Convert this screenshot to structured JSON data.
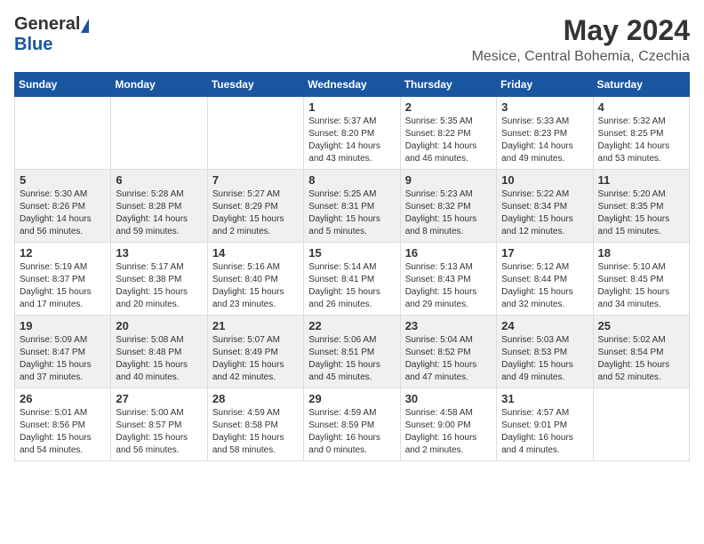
{
  "header": {
    "logo_general": "General",
    "logo_blue": "Blue",
    "month": "May 2024",
    "location": "Mesice, Central Bohemia, Czechia"
  },
  "weekdays": [
    "Sunday",
    "Monday",
    "Tuesday",
    "Wednesday",
    "Thursday",
    "Friday",
    "Saturday"
  ],
  "weeks": [
    [
      {
        "day": "",
        "info": ""
      },
      {
        "day": "",
        "info": ""
      },
      {
        "day": "",
        "info": ""
      },
      {
        "day": "1",
        "info": "Sunrise: 5:37 AM\nSunset: 8:20 PM\nDaylight: 14 hours\nand 43 minutes."
      },
      {
        "day": "2",
        "info": "Sunrise: 5:35 AM\nSunset: 8:22 PM\nDaylight: 14 hours\nand 46 minutes."
      },
      {
        "day": "3",
        "info": "Sunrise: 5:33 AM\nSunset: 8:23 PM\nDaylight: 14 hours\nand 49 minutes."
      },
      {
        "day": "4",
        "info": "Sunrise: 5:32 AM\nSunset: 8:25 PM\nDaylight: 14 hours\nand 53 minutes."
      }
    ],
    [
      {
        "day": "5",
        "info": "Sunrise: 5:30 AM\nSunset: 8:26 PM\nDaylight: 14 hours\nand 56 minutes."
      },
      {
        "day": "6",
        "info": "Sunrise: 5:28 AM\nSunset: 8:28 PM\nDaylight: 14 hours\nand 59 minutes."
      },
      {
        "day": "7",
        "info": "Sunrise: 5:27 AM\nSunset: 8:29 PM\nDaylight: 15 hours\nand 2 minutes."
      },
      {
        "day": "8",
        "info": "Sunrise: 5:25 AM\nSunset: 8:31 PM\nDaylight: 15 hours\nand 5 minutes."
      },
      {
        "day": "9",
        "info": "Sunrise: 5:23 AM\nSunset: 8:32 PM\nDaylight: 15 hours\nand 8 minutes."
      },
      {
        "day": "10",
        "info": "Sunrise: 5:22 AM\nSunset: 8:34 PM\nDaylight: 15 hours\nand 12 minutes."
      },
      {
        "day": "11",
        "info": "Sunrise: 5:20 AM\nSunset: 8:35 PM\nDaylight: 15 hours\nand 15 minutes."
      }
    ],
    [
      {
        "day": "12",
        "info": "Sunrise: 5:19 AM\nSunset: 8:37 PM\nDaylight: 15 hours\nand 17 minutes."
      },
      {
        "day": "13",
        "info": "Sunrise: 5:17 AM\nSunset: 8:38 PM\nDaylight: 15 hours\nand 20 minutes."
      },
      {
        "day": "14",
        "info": "Sunrise: 5:16 AM\nSunset: 8:40 PM\nDaylight: 15 hours\nand 23 minutes."
      },
      {
        "day": "15",
        "info": "Sunrise: 5:14 AM\nSunset: 8:41 PM\nDaylight: 15 hours\nand 26 minutes."
      },
      {
        "day": "16",
        "info": "Sunrise: 5:13 AM\nSunset: 8:43 PM\nDaylight: 15 hours\nand 29 minutes."
      },
      {
        "day": "17",
        "info": "Sunrise: 5:12 AM\nSunset: 8:44 PM\nDaylight: 15 hours\nand 32 minutes."
      },
      {
        "day": "18",
        "info": "Sunrise: 5:10 AM\nSunset: 8:45 PM\nDaylight: 15 hours\nand 34 minutes."
      }
    ],
    [
      {
        "day": "19",
        "info": "Sunrise: 5:09 AM\nSunset: 8:47 PM\nDaylight: 15 hours\nand 37 minutes."
      },
      {
        "day": "20",
        "info": "Sunrise: 5:08 AM\nSunset: 8:48 PM\nDaylight: 15 hours\nand 40 minutes."
      },
      {
        "day": "21",
        "info": "Sunrise: 5:07 AM\nSunset: 8:49 PM\nDaylight: 15 hours\nand 42 minutes."
      },
      {
        "day": "22",
        "info": "Sunrise: 5:06 AM\nSunset: 8:51 PM\nDaylight: 15 hours\nand 45 minutes."
      },
      {
        "day": "23",
        "info": "Sunrise: 5:04 AM\nSunset: 8:52 PM\nDaylight: 15 hours\nand 47 minutes."
      },
      {
        "day": "24",
        "info": "Sunrise: 5:03 AM\nSunset: 8:53 PM\nDaylight: 15 hours\nand 49 minutes."
      },
      {
        "day": "25",
        "info": "Sunrise: 5:02 AM\nSunset: 8:54 PM\nDaylight: 15 hours\nand 52 minutes."
      }
    ],
    [
      {
        "day": "26",
        "info": "Sunrise: 5:01 AM\nSunset: 8:56 PM\nDaylight: 15 hours\nand 54 minutes."
      },
      {
        "day": "27",
        "info": "Sunrise: 5:00 AM\nSunset: 8:57 PM\nDaylight: 15 hours\nand 56 minutes."
      },
      {
        "day": "28",
        "info": "Sunrise: 4:59 AM\nSunset: 8:58 PM\nDaylight: 15 hours\nand 58 minutes."
      },
      {
        "day": "29",
        "info": "Sunrise: 4:59 AM\nSunset: 8:59 PM\nDaylight: 16 hours\nand 0 minutes."
      },
      {
        "day": "30",
        "info": "Sunrise: 4:58 AM\nSunset: 9:00 PM\nDaylight: 16 hours\nand 2 minutes."
      },
      {
        "day": "31",
        "info": "Sunrise: 4:57 AM\nSunset: 9:01 PM\nDaylight: 16 hours\nand 4 minutes."
      },
      {
        "day": "",
        "info": ""
      }
    ]
  ]
}
